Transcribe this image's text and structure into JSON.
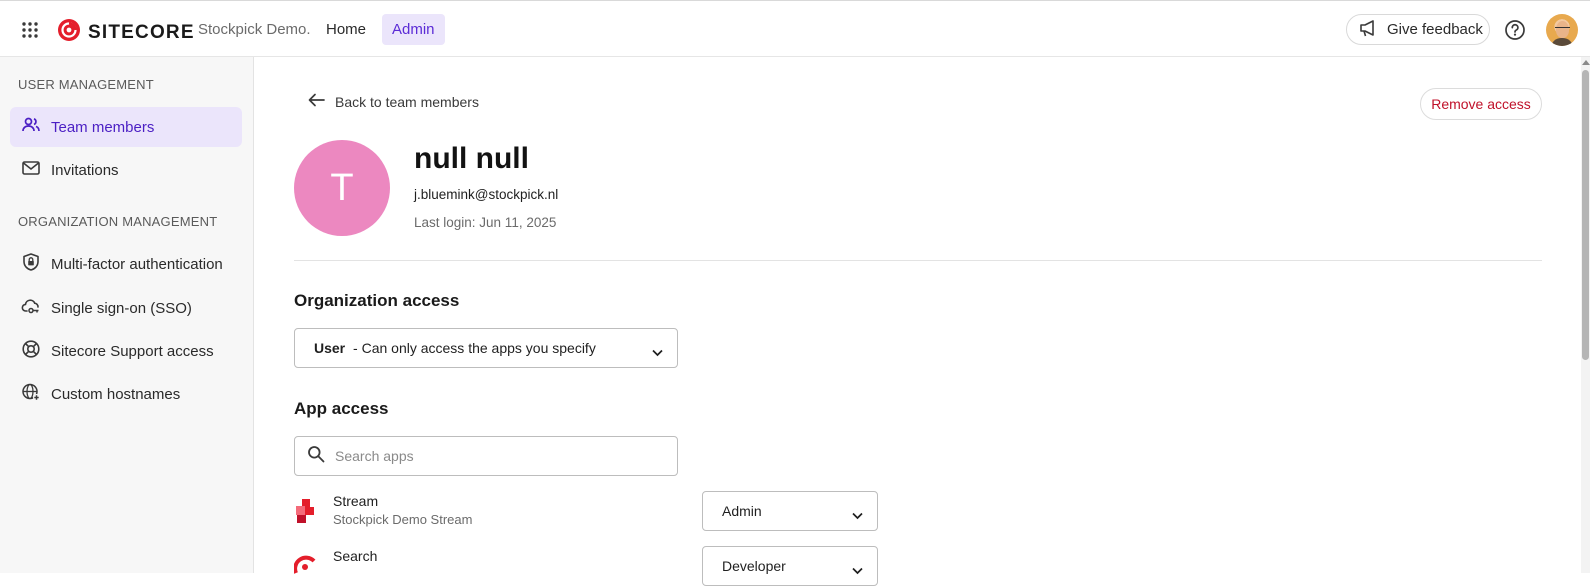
{
  "header": {
    "brand": "SITECORE",
    "org_name": "Stockpick Demo.",
    "nav": {
      "home": "Home",
      "admin": "Admin"
    },
    "feedback_label": "Give feedback",
    "icons": [
      "apps-grid-icon",
      "sitecore-logo-icon",
      "megaphone-icon",
      "help-icon",
      "user-avatar"
    ]
  },
  "sidebar": {
    "user_management": {
      "heading": "USER MANAGEMENT",
      "items": [
        {
          "label": "Team members",
          "icon": "users-icon",
          "active": true
        },
        {
          "label": "Invitations",
          "icon": "mail-icon",
          "active": false
        }
      ]
    },
    "organization_management": {
      "heading": "ORGANIZATION MANAGEMENT",
      "items": [
        {
          "label": "Multi-factor authentication",
          "icon": "shield-lock-icon"
        },
        {
          "label": "Single sign-on (SSO)",
          "icon": "cloud-key-icon"
        },
        {
          "label": "Sitecore Support access",
          "icon": "lifebuoy-icon"
        },
        {
          "label": "Custom hostnames",
          "icon": "globe-plus-icon"
        }
      ]
    }
  },
  "main": {
    "back_label": "Back to team members",
    "remove_label": "Remove access",
    "user": {
      "initial": "T",
      "name": "null null",
      "email": "j.bluemink@stockpick.nl",
      "last_login": "Last login: Jun 11, 2025"
    },
    "org_access": {
      "title": "Organization access",
      "selected_role": "User",
      "selected_desc": " - Can only access the apps you specify"
    },
    "app_access": {
      "title": "App access",
      "search_placeholder": "Search apps",
      "apps": [
        {
          "name": "Stream",
          "subtitle": "Stockpick Demo Stream",
          "role": "Admin",
          "icon": "stream-app-icon"
        },
        {
          "name": "Search",
          "subtitle": "",
          "role": "Developer",
          "icon": "search-app-icon"
        }
      ]
    }
  },
  "colors": {
    "accent": "#5b2bd6",
    "active_bg": "#ebe5fb",
    "brand_red": "#e41e2b",
    "danger": "#c0112a",
    "avatar_pink": "#ec88c0"
  }
}
